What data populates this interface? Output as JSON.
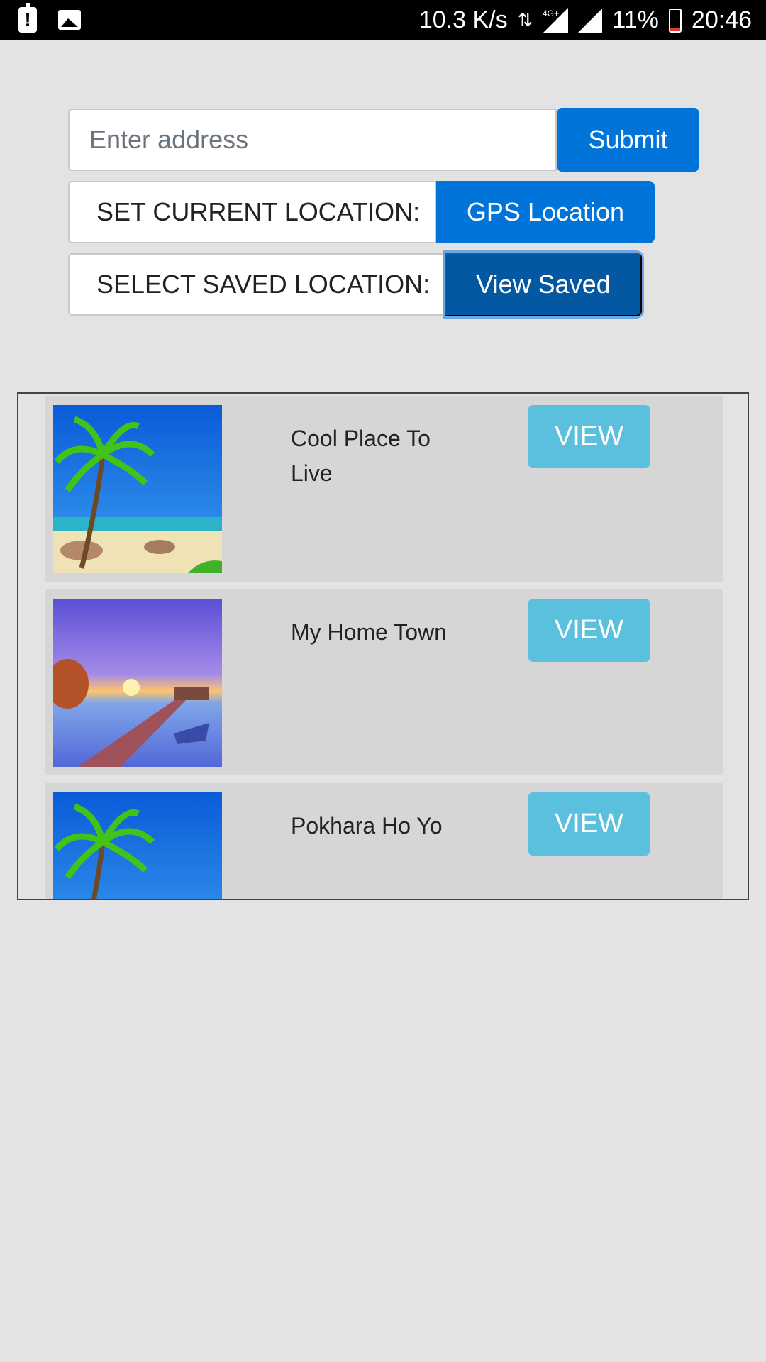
{
  "status_bar": {
    "speed": "10.3 K/s",
    "network": "4G+",
    "battery": "11%",
    "battery_level": 0.11,
    "time": "20:46",
    "icons": [
      "alert-icon",
      "image-icon",
      "data-arrows-icon",
      "signal-icon",
      "battery-icon"
    ]
  },
  "address": {
    "placeholder": "Enter address",
    "value": "",
    "submit_label": "Submit"
  },
  "current_location": {
    "label": "SET CURRENT LOCATION:",
    "button_label": "GPS Location"
  },
  "saved_location": {
    "label": "SELECT SAVED LOCATION:",
    "button_label": "View Saved"
  },
  "places": [
    {
      "name": "Cool Place To Live",
      "image": "beach-palm-image",
      "view_label": "VIEW"
    },
    {
      "name": "My Home Town",
      "image": "sunset-pier-image",
      "view_label": "VIEW"
    },
    {
      "name": "Pokhara Ho Yo",
      "image": "beach-palm-image",
      "view_label": "VIEW"
    }
  ],
  "colors": {
    "primary": "#0074d9",
    "primary_active": "#0457a1",
    "info": "#5bc0de",
    "page_bg": "#e3e3e3",
    "row_bg": "#d6d6d6"
  }
}
